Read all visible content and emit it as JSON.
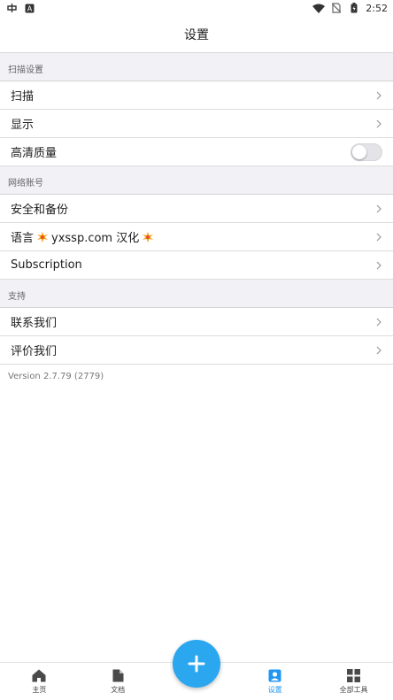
{
  "status_bar": {
    "time": "2:52"
  },
  "header": {
    "title": "设置"
  },
  "sections": [
    {
      "title": "扫描设置",
      "items": [
        {
          "label": "扫描",
          "type": "link"
        },
        {
          "label": "显示",
          "type": "link"
        },
        {
          "label": "高清质量",
          "type": "toggle",
          "value": false
        }
      ]
    },
    {
      "title": "网络账号",
      "items": [
        {
          "label": "安全和备份",
          "type": "link"
        },
        {
          "label_prefix": "语言",
          "label_middle": "yxssp.com 汉化",
          "type": "link"
        },
        {
          "label": "Subscription",
          "type": "link"
        }
      ]
    },
    {
      "title": "支持",
      "items": [
        {
          "label": "联系我们",
          "type": "link"
        },
        {
          "label": "评价我们",
          "type": "link"
        }
      ]
    }
  ],
  "version_text": "Version 2.7.79 (2779)",
  "tab_bar": {
    "tabs": [
      {
        "label": "主页",
        "icon": "home-icon",
        "active": false
      },
      {
        "label": "文档",
        "icon": "document-icon",
        "active": false
      },
      {
        "label": "设置",
        "icon": "settings-person-icon",
        "active": true
      },
      {
        "label": "全部工具",
        "icon": "grid-icon",
        "active": false
      }
    ],
    "fab_icon": "plus-icon"
  },
  "colors": {
    "accent": "#2196f3",
    "fab": "#2ba7f0",
    "section_bg": "#f2f2f6"
  }
}
